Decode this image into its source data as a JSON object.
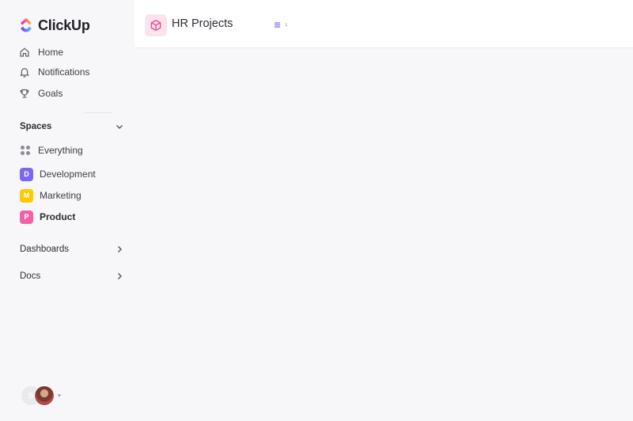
{
  "app": {
    "brand": "ClickUp"
  },
  "nav": {
    "items": [
      {
        "label": "Home",
        "icon": "home-icon"
      },
      {
        "label": "Notifications",
        "icon": "bell-icon"
      },
      {
        "label": "Goals",
        "icon": "trophy-icon"
      }
    ]
  },
  "spaces": {
    "header": "Spaces",
    "everything_label": "Everything",
    "items": [
      {
        "label": "Development",
        "initial": "D",
        "color": "#7b68ee"
      },
      {
        "label": "Marketing",
        "initial": "M",
        "color": "#ffc800"
      },
      {
        "label": "Product",
        "initial": "P",
        "color": "#f062a8"
      }
    ]
  },
  "sections": {
    "dashboards": "Dashboards",
    "docs": "Docs"
  },
  "header": {
    "project_title": "HR Projects",
    "view_label": "L"
  },
  "user": {
    "initial": "S"
  }
}
